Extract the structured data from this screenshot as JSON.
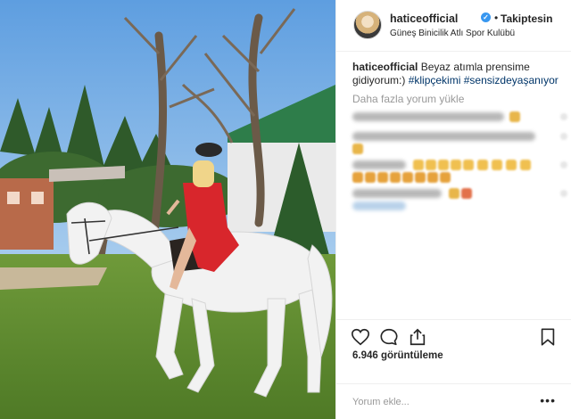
{
  "post": {
    "author": {
      "username": "haticeofficial",
      "verified": true,
      "follow_status": "Takiptesin",
      "location": "Güneş Binicilik Atlı Spor Kulübü"
    },
    "caption": {
      "username": "haticeofficial",
      "text": "Beyaz atımla prensime gidiyorum:)",
      "hashtags": [
        "#klipçekimi",
        "#sensizdeyaşanıyor"
      ]
    },
    "load_more_label": "Daha fazla yorum yükle",
    "comments_blurred": true,
    "views": "6.946 görüntüleme",
    "add_comment_placeholder": "Yorum ekle...",
    "more_options_label": "•••"
  },
  "icons": {
    "like": "heart-icon",
    "comment": "comment-bubble-icon",
    "share": "share-icon",
    "save": "bookmark-icon",
    "verified": "verified-badge-icon"
  },
  "colors": {
    "accent_blue": "#3897f0",
    "hashtag": "#003569",
    "muted_text": "#999999",
    "border": "#efefef"
  }
}
